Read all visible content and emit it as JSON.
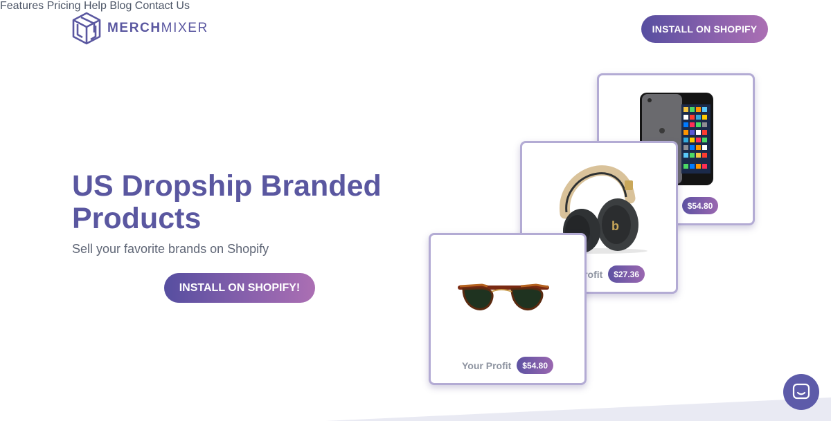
{
  "brand": {
    "name_bold": "MERCH",
    "name_light": "MIXER"
  },
  "nav": {
    "items": [
      "Features",
      "Pricing",
      "Help",
      "Blog",
      "Contact Us"
    ],
    "install_label": "INSTALL ON SHOPIFY"
  },
  "hero": {
    "title": "US Dropship Branded Products",
    "subtitle": "Sell your favorite brands on Shopify",
    "install_label": "INSTALL ON SHOPIFY!"
  },
  "products": {
    "ipod": {
      "price": "$54.80",
      "screen_label": "iPod"
    },
    "headphones": {
      "profit_label": "Your Profit",
      "price": "$27.36"
    },
    "sunglasses": {
      "profit_label": "Your Profit",
      "price": "$54.80"
    }
  },
  "colors": {
    "brand_purple": "#5a57a0",
    "button_gradient_start": "#564ea0",
    "button_gradient_end": "#ab6fb3",
    "card_border": "#b3abd4"
  },
  "icons": {
    "logo": "merchmixer-cube-logo-icon",
    "chat": "chat-bubble-icon"
  }
}
